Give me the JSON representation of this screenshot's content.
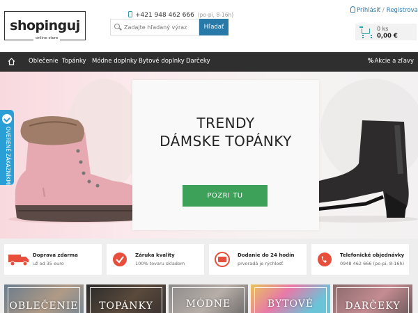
{
  "header": {
    "logo_text": "shopinguj",
    "logo_subtitle": "online store",
    "phone": "+421 948 462 666",
    "phone_hours": "(po-pi, 8-16h)",
    "search_placeholder": "Zadajte hľadaný výraz",
    "search_button": "Hľadať",
    "login": "Prihlásiť",
    "account_separator": "/",
    "register": "Registrovať",
    "cart_count": "0 ks",
    "cart_total": "0,00 €"
  },
  "nav": {
    "items": [
      "Oblečenie",
      "Topánky",
      "Módne doplnky",
      "Bytové doplnky",
      "Darčeky"
    ],
    "promo": "Akcie a zľavy"
  },
  "hero": {
    "title_line1": "TRENDY",
    "title_line2": "DÁMSKE TOPÁNKY",
    "cta": "POZRI TU"
  },
  "verified_tab": "OVERENÉ ZÁKAZNÍKMI",
  "benefits": [
    {
      "title": "Doprava zdarma",
      "subtitle": "už od 35 euro",
      "icon": "truck-icon"
    },
    {
      "title": "Záruka kvality",
      "subtitle": "100% tovaru skladom",
      "icon": "quality-check-icon"
    },
    {
      "title": "Dodanie do 24 hodín",
      "subtitle": "prvoradá je rýchlosť",
      "icon": "24h-delivery-icon"
    },
    {
      "title": "Telefonické objednávky",
      "subtitle": "0948 462 666 (po-pi, 8-16h)",
      "icon": "phone-icon"
    }
  ],
  "categories": [
    "OBLEČENIE",
    "TOPÁNKY",
    "MÓDNE",
    "BYTOVÉ",
    "DARČEKY"
  ],
  "colors": {
    "accent_blue": "#2878a8",
    "nav_bg": "#2f2f2f",
    "cta_green": "#3ea15a",
    "icon_red": "#e84e3c",
    "verified_blue": "#2a9fd6"
  }
}
